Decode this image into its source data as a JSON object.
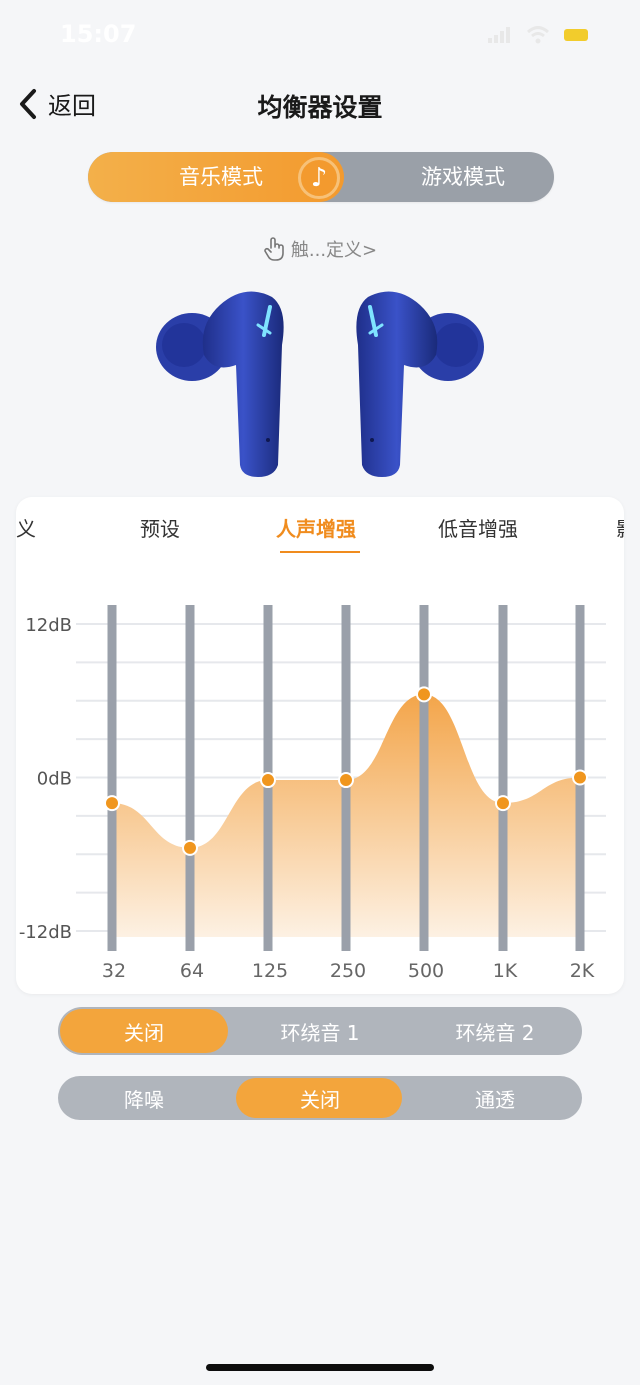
{
  "status_bar": {
    "time": "15:07"
  },
  "nav": {
    "back_label": "返回",
    "title": "均衡器设置"
  },
  "mode_switch": {
    "music": "音乐模式",
    "game": "游戏模式",
    "selected": "music"
  },
  "custom_link": "触...定义>",
  "eq_tabs": {
    "partial_left": "义",
    "preset": "预设",
    "vocal": "人声增强",
    "bass": "低音增强",
    "partial_right": "影",
    "selected": "vocal"
  },
  "eq_chart": {
    "y_labels": [
      "12dB",
      "0dB",
      "-12dB"
    ],
    "bands": [
      "32",
      "64",
      "125",
      "250",
      "500",
      "1K",
      "2K"
    ]
  },
  "chart_data": {
    "type": "area",
    "x": [
      "32",
      "64",
      "125",
      "250",
      "500",
      "1K",
      "2K"
    ],
    "y": [
      -2,
      -5.5,
      -0.2,
      -0.2,
      6.5,
      -2,
      0
    ],
    "ylim": [
      -12,
      12
    ],
    "yticks": [
      "12dB",
      "0dB",
      "-12dB"
    ],
    "grid": true,
    "colors": {
      "accent": "#f0961e",
      "fill_top": "#f3a54a",
      "fill_bottom": "#fdf1e3",
      "slider": "#9aa0aa"
    }
  },
  "surround": {
    "off": "关闭",
    "mode1": "环绕音 1",
    "mode2": "环绕音 2",
    "selected": "off"
  },
  "noise": {
    "anc": "降噪",
    "off": "关闭",
    "transparent": "通透",
    "selected": "off"
  }
}
